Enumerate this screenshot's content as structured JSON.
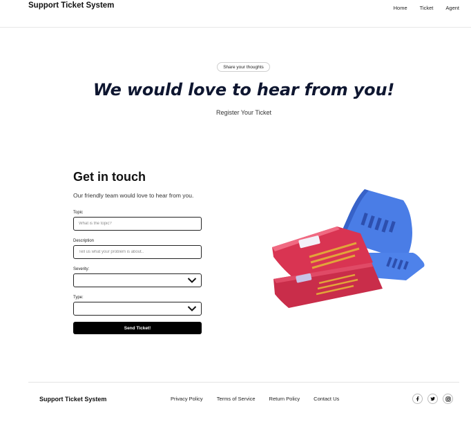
{
  "header": {
    "brand": "Support Ticket System",
    "nav": [
      "Home",
      "Ticket",
      "Agent"
    ]
  },
  "hero": {
    "pill": "Share your thoughts",
    "title": "We would love to hear from you!",
    "subtitle": "Register Your Ticket"
  },
  "form": {
    "heading": "Get in touch",
    "lead": "Our friendly team would love to hear from you.",
    "topic_label": "Topic",
    "topic_placeholder": "What is the topic?",
    "description_label": "Description",
    "description_placeholder": "Tell us what your problem is about..",
    "severity_label": "Severity:",
    "type_label": "Type:",
    "submit_label": "Send Ticket!"
  },
  "illustration": {
    "icon": "tickets-icon",
    "colors": {
      "blue": "#4a7de6",
      "red": "#d93452",
      "yellow": "#e2a43a"
    }
  },
  "footer": {
    "brand": "Support Ticket System",
    "links": [
      "Privacy Policy",
      "Terms of Service",
      "Return Policy",
      "Contact Us"
    ],
    "social": [
      "facebook-icon",
      "twitter-icon",
      "instagram-icon"
    ]
  }
}
